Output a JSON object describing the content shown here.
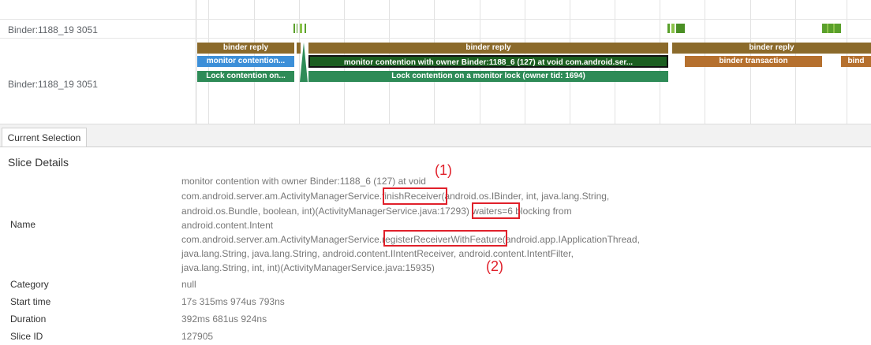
{
  "tracks": {
    "row1_label": "Binder:1188_19 3051",
    "row2_label": "Binder:1188_19 3051"
  },
  "slices": {
    "binder_reply_1": "binder reply",
    "binder_reply_2": "binder reply",
    "binder_reply_3": "binder reply",
    "monitor_short": "monitor contention...",
    "monitor_long": "monitor contention with owner Binder:1188_6 (127) at void com.android.ser...",
    "binder_transaction": "binder transaction",
    "binder_cut": "bind",
    "lock_short": "Lock contention on...",
    "lock_long": "Lock contention on a monitor lock (owner tid: 1694)"
  },
  "tab": {
    "label": "Current Selection"
  },
  "details": {
    "title": "Slice Details",
    "name_label": "Name",
    "name_lines": [
      "monitor contention with owner Binder:1188_6 (127) at void",
      "com.android.server.am.ActivityManagerService.finishReceiver(android.os.IBinder, int, java.lang.String,",
      "android.os.Bundle, boolean, int)(ActivityManagerService.java:17293) waiters=6 blocking from",
      "android.content.Intent",
      "com.android.server.am.ActivityManagerService.registerReceiverWithFeature(android.app.IApplicationThread,",
      "java.lang.String, java.lang.String, android.content.IIntentReceiver, android.content.IntentFilter,",
      "java.lang.String, int, int)(ActivityManagerService.java:15935)"
    ],
    "category_label": "Category",
    "category_value": "null",
    "start_label": "Start time",
    "start_value": "17s 315ms 974us 793ns",
    "duration_label": "Duration",
    "duration_value": "392ms 681us 924ns",
    "id_label": "Slice ID",
    "id_value": "127905"
  },
  "annotations": {
    "a1": "(1)",
    "a2": "(2)"
  },
  "colors": {
    "binder_reply": "#8b6a2b",
    "monitor": "#3c8fd8",
    "monitor_selected": "#1b5e20",
    "lock": "#2e8b57",
    "binder_transaction": "#b5702e",
    "highlight": "#e0202a"
  }
}
